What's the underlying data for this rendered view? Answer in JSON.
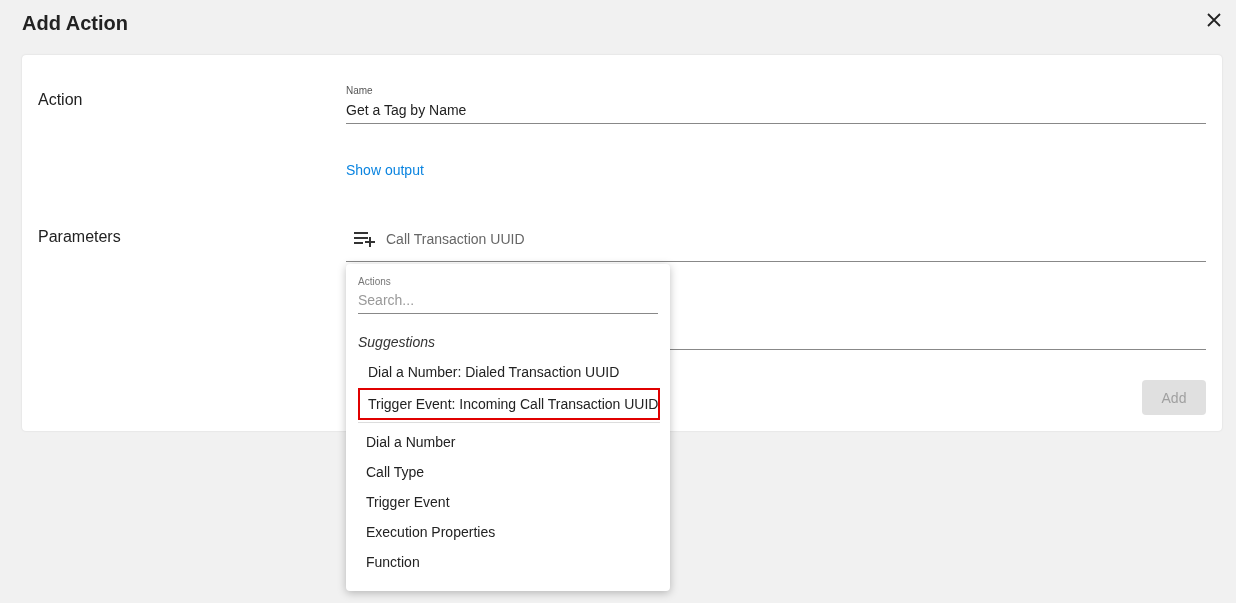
{
  "dialog": {
    "title": "Add Action"
  },
  "action_section": {
    "label": "Action",
    "name_field": {
      "label": "Name",
      "value": "Get a Tag by Name"
    },
    "show_output_link": "Show output"
  },
  "parameters_section": {
    "label": "Parameters",
    "parameter_field": {
      "placeholder": "Call Transaction UUID"
    }
  },
  "add_button": {
    "label": "Add",
    "disabled": true
  },
  "actions_menu": {
    "search_label": "Actions",
    "search_placeholder": "Search...",
    "suggestions_heading": "Suggestions",
    "suggestions": [
      {
        "label": "Dial a Number: Dialed Transaction UUID",
        "highlighted": false
      },
      {
        "label": "Trigger Event: Incoming Call Transaction UUID",
        "highlighted": true
      }
    ],
    "items": [
      {
        "label": "Dial a Number"
      },
      {
        "label": "Call Type"
      },
      {
        "label": "Trigger Event"
      },
      {
        "label": "Execution Properties"
      },
      {
        "label": "Function"
      }
    ]
  }
}
